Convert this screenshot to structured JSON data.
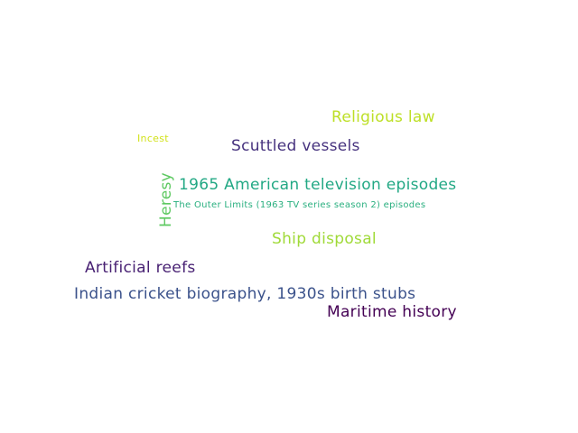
{
  "words": [
    {
      "text": "Religious law",
      "color": "#bddf26"
    },
    {
      "text": "Incest",
      "color": "#d2e21b"
    },
    {
      "text": "Scuttled vessels",
      "color": "#46327e"
    },
    {
      "text": "Heresy",
      "color": "#5ec962"
    },
    {
      "text": "1965 American television episodes",
      "color": "#22a884"
    },
    {
      "text": "The Outer Limits (1963 TV series season 2) episodes",
      "color": "#29af7f"
    },
    {
      "text": "Ship disposal",
      "color": "#a0da39"
    },
    {
      "text": "Artificial reefs",
      "color": "#482173"
    },
    {
      "text": "Indian cricket biography, 1930s birth stubs",
      "color": "#3b528b"
    },
    {
      "text": "Maritime history",
      "color": "#440154"
    }
  ]
}
